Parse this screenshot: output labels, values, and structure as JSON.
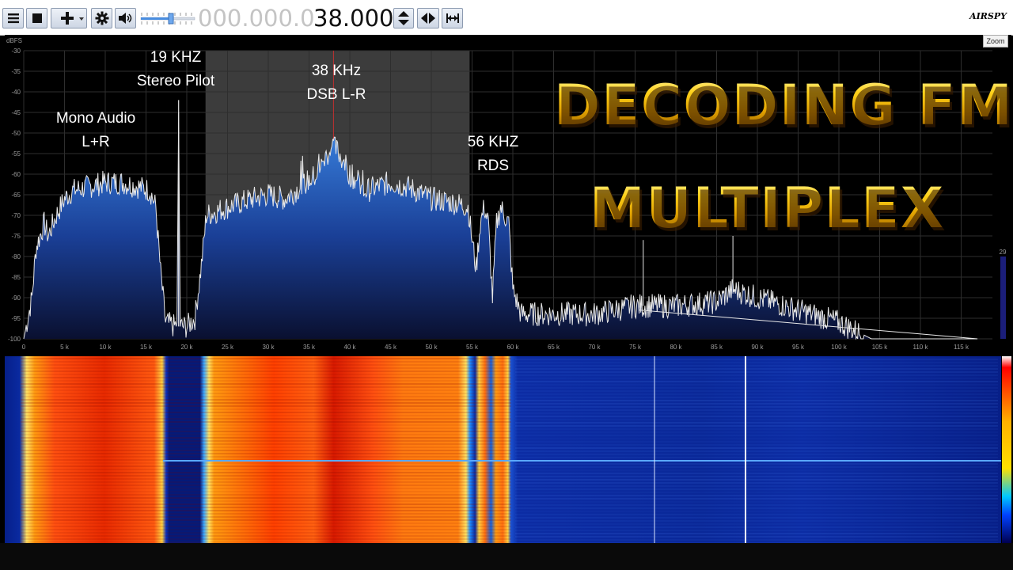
{
  "toolbar": {
    "menu_icon": "hamburger-menu-icon",
    "stop_icon": "stop-icon",
    "add_icon": "plus-icon",
    "settings_icon": "gear-icon",
    "audio_icon": "speaker-icon",
    "frequency_dim": "000.000.0",
    "frequency_bright": "38.000",
    "step_icon": "up-down-arrows-icon",
    "center_icon": "left-right-arrows-icon",
    "span_icon": "bandwidth-icon",
    "logo": "AIRSPY"
  },
  "zoom_label": "Zoom",
  "spectrum": {
    "unit": "dBFS",
    "y_labels": [
      "-30",
      "-35",
      "-40",
      "-45",
      "-50",
      "-55",
      "-60",
      "-65",
      "-70",
      "-75",
      "-80",
      "-85",
      "-90",
      "-95",
      "-100"
    ],
    "x_labels": [
      "0",
      "5 k",
      "10 k",
      "15 k",
      "20 k",
      "25 k",
      "30 k",
      "35 k",
      "40 k",
      "45 k",
      "50 k",
      "55 k",
      "60 k",
      "65 k",
      "70 k",
      "75 k",
      "80 k",
      "85 k",
      "90 k",
      "95 k",
      "100 k",
      "105 k",
      "110 k",
      "115 k"
    ],
    "side_value": "29"
  },
  "annotations": {
    "pilot_line1": "19 KHZ",
    "pilot_line2": "Stereo Pilot",
    "mono_line1": "Mono Audio",
    "mono_line2": "L+R",
    "dsb_line1": "38 KHz",
    "dsb_line2": "DSB L-R",
    "rds_line1": "56 KHZ",
    "rds_line2": "RDS"
  },
  "headline": {
    "line1": "DECODING FM",
    "line2": "MULTIPLEX"
  },
  "colors": {
    "accent_blue": "#1e63c8",
    "headline_gold": "#ffd21a"
  }
}
